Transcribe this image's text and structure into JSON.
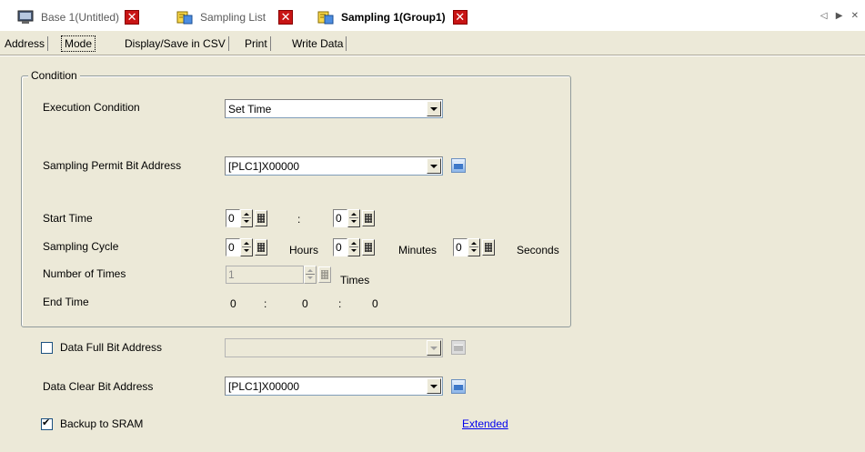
{
  "doc_tabs": [
    {
      "label": "Base 1(Untitled)",
      "icon": "screen-icon"
    },
    {
      "label": "Sampling List",
      "icon": "sampling-icon"
    },
    {
      "label": "Sampling 1(Group1)",
      "icon": "sampling-icon",
      "active": true
    }
  ],
  "close_glyph": "✕",
  "tab_scroll": "◁ ▶ ✕",
  "sub_tabs": [
    "Address",
    "Mode",
    "Display/Save in CSV",
    "Print",
    "Write Data"
  ],
  "condition": {
    "legend": "Condition",
    "execution_label": "Execution Condition",
    "execution_value": "Set Time",
    "permit_label": "Sampling Permit Bit Address",
    "permit_value": "[PLC1]X00000",
    "start_label": "Start Time",
    "start_hours": "0",
    "start_sep": ":",
    "start_minutes": "0",
    "cycle_label": "Sampling Cycle",
    "cycle_hours": "0",
    "cycle_hours_unit": "Hours",
    "cycle_minutes": "0",
    "cycle_minutes_unit": "Minutes",
    "cycle_seconds": "0",
    "cycle_seconds_unit": "Seconds",
    "times_label": "Number of Times",
    "times_value": "1",
    "times_unit": "Times",
    "end_label": "End Time",
    "end_h": "0",
    "end_sep1": ":",
    "end_m": "0",
    "end_sep2": ":",
    "end_s": "0"
  },
  "data_full": {
    "label": "Data Full Bit Address",
    "checked": false,
    "value": ""
  },
  "data_clear": {
    "label": "Data Clear Bit Address",
    "value": "[PLC1]X00000"
  },
  "backup": {
    "label": "Backup to SRAM",
    "checked": true
  },
  "extended_link": "Extended"
}
